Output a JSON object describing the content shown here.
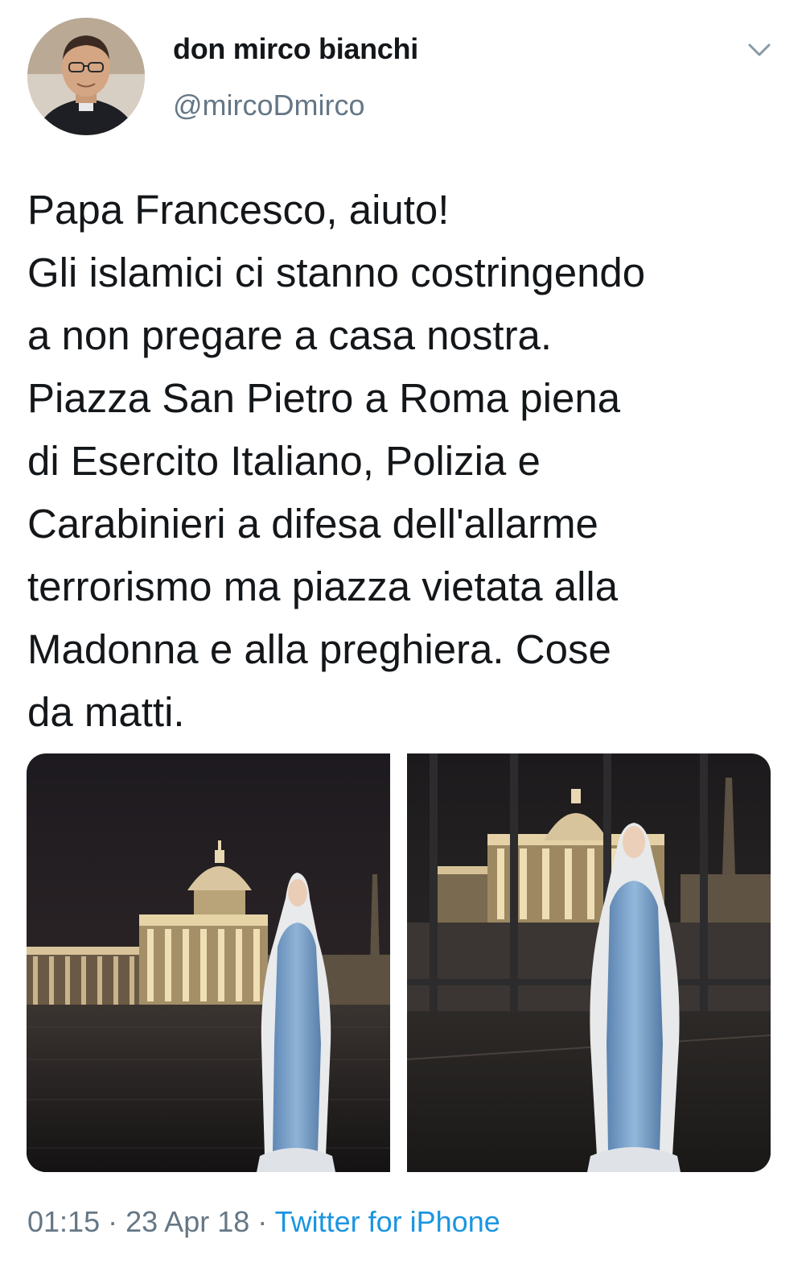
{
  "user": {
    "display_name": "don mirco bianchi",
    "handle": "@mircoDmirco",
    "avatar_icon": "user-avatar"
  },
  "menu_icon": "chevron-down-icon",
  "tweet": {
    "lines": [
      "Papa Francesco, aiuto!",
      "Gli islamici ci stanno costringendo",
      "a non pregare a casa nostra.",
      "Piazza San Pietro a Roma piena",
      "di Esercito Italiano, Polizia e",
      "Carabinieri a difesa dell'allarme",
      "terrorismo ma piazza vietata alla",
      "Madonna e alla preghiera. Cose",
      "da matti."
    ]
  },
  "media": [
    {
      "name": "photo-statue-piazza"
    },
    {
      "name": "photo-statue-fence"
    }
  ],
  "meta": {
    "time": "01:15",
    "date": "23 Apr 18",
    "separator": "·",
    "source": "Twitter for iPhone"
  },
  "colors": {
    "text": "#14171a",
    "secondary": "#657786",
    "link": "#1b95e0"
  }
}
